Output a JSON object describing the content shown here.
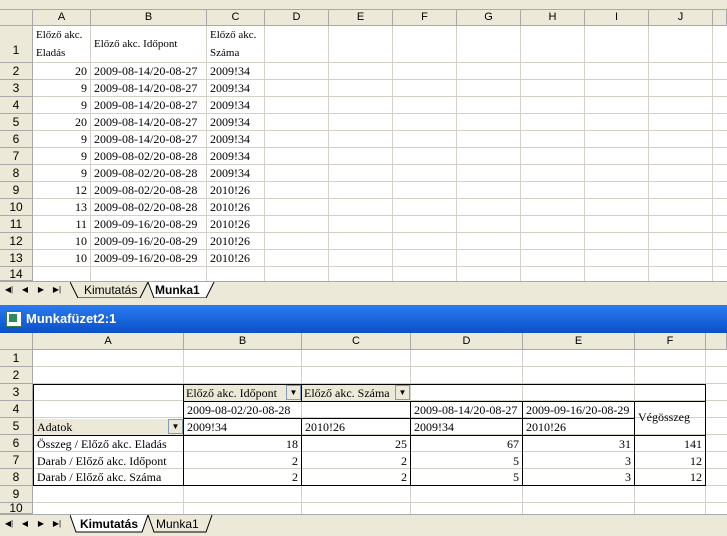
{
  "top_sheet": {
    "columns": [
      "A",
      "B",
      "C",
      "D",
      "E",
      "F",
      "G",
      "H",
      "I",
      "J"
    ],
    "rows": [
      "1",
      "2",
      "3",
      "4",
      "5",
      "6",
      "7",
      "8",
      "9",
      "10",
      "11",
      "12",
      "13",
      "14"
    ],
    "header_row": {
      "a_line1": "Előző akc.",
      "a_line2": "Eladás",
      "b": "Előző akc. Időpont",
      "c_line1": "Előző akc.",
      "c_line2": "Száma"
    },
    "data": [
      [
        "20",
        "2009-08-14/20-08-27",
        "2009!34"
      ],
      [
        "9",
        "2009-08-14/20-08-27",
        "2009!34"
      ],
      [
        "9",
        "2009-08-14/20-08-27",
        "2009!34"
      ],
      [
        "20",
        "2009-08-14/20-08-27",
        "2009!34"
      ],
      [
        "9",
        "2009-08-14/20-08-27",
        "2009!34"
      ],
      [
        "9",
        "2009-08-02/20-08-28",
        "2009!34"
      ],
      [
        "9",
        "2009-08-02/20-08-28",
        "2009!34"
      ],
      [
        "12",
        "2009-08-02/20-08-28",
        "2010!26"
      ],
      [
        "13",
        "2009-08-02/20-08-28",
        "2010!26"
      ],
      [
        "11",
        "2009-09-16/20-08-29",
        "2010!26"
      ],
      [
        "10",
        "2009-09-16/20-08-29",
        "2010!26"
      ],
      [
        "10",
        "2009-09-16/20-08-29",
        "2010!26"
      ]
    ],
    "tabs": [
      "Kimutatás",
      "Munka1"
    ],
    "active_tab": "Munka1"
  },
  "window": {
    "title": "Munkafüzet2:1"
  },
  "bottom_sheet": {
    "columns": [
      "A",
      "B",
      "C",
      "D",
      "E",
      "F"
    ],
    "rows": [
      "1",
      "2",
      "3",
      "4",
      "5",
      "6",
      "7",
      "8",
      "9",
      "10"
    ],
    "pivot": {
      "col_field_1": "Előző akc. Időpont",
      "col_field_2": "Előző akc. Száma",
      "date_1": "2009-08-02/20-08-28",
      "date_2": "2009-08-14/20-08-27",
      "date_3": "2009-09-16/20-08-29",
      "grand_total": "Végösszeg",
      "data_field": "Adatok",
      "sub": [
        "2009!34",
        "2010!26",
        "2009!34",
        "2010!26"
      ],
      "rows": [
        {
          "label": "Összeg / Előző akc. Eladás",
          "values": [
            "18",
            "25",
            "67",
            "31",
            "141"
          ]
        },
        {
          "label": "Darab / Előző akc. Időpont",
          "values": [
            "2",
            "2",
            "5",
            "3",
            "12"
          ]
        },
        {
          "label": "Darab / Előző akc. Száma",
          "values": [
            "2",
            "2",
            "5",
            "3",
            "12"
          ]
        }
      ]
    },
    "tabs": [
      "Kimutatás",
      "Munka1"
    ],
    "active_tab": "Kimutatás"
  },
  "colors": {
    "titlebar": "#0a50c8",
    "header_bg": "#ece9d8",
    "grid": "#d4d0c8"
  }
}
